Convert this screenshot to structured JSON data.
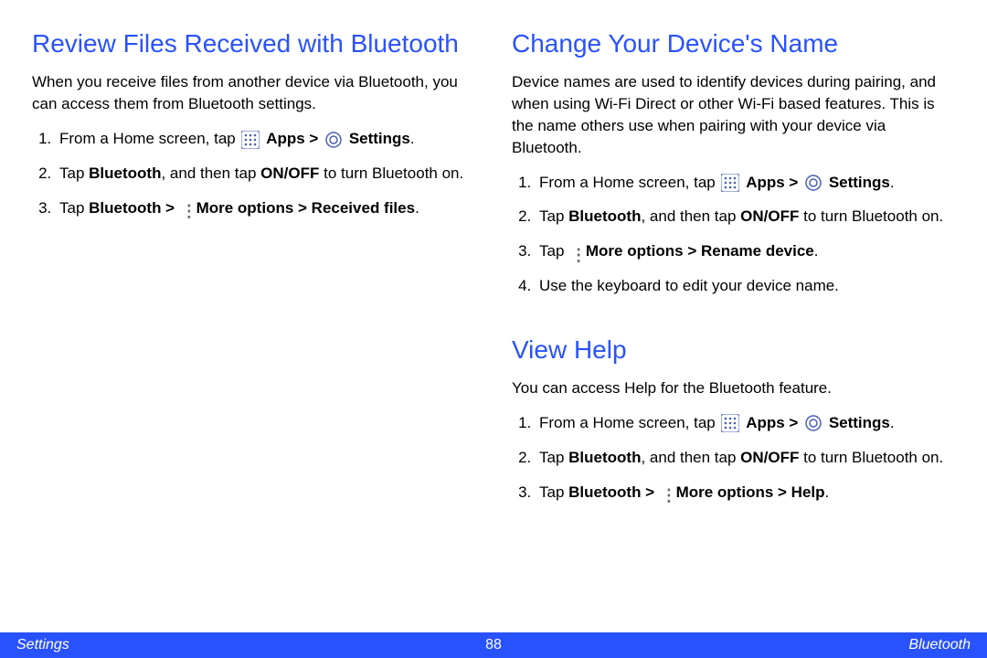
{
  "left": {
    "section1": {
      "heading": "Review Files Received with Bluetooth",
      "intro": "When you receive files from another device via Bluetooth, you can access them from Bluetooth settings.",
      "steps": {
        "s1_prefix": "From a Home screen, tap ",
        "s1_apps": "Apps > ",
        "s1_settings": "Settings",
        "s2_a": "Tap ",
        "s2_b": "Bluetooth",
        "s2_c": ", and then tap ",
        "s2_d": "ON/OFF",
        "s2_e": " to turn Bluetooth on.",
        "s3_a": "Tap ",
        "s3_b": "Bluetooth > ",
        "s3_c": "More options > Received files"
      }
    }
  },
  "right": {
    "section1": {
      "heading": "Change Your Device's Name",
      "intro": "Device names are used to identify devices during pairing, and when using Wi-Fi Direct or other Wi-Fi based features. This is the name others use when pairing with your device via Bluetooth.",
      "steps": {
        "s1_prefix": "From a Home screen, tap ",
        "s1_apps": "Apps > ",
        "s1_settings": "Settings",
        "s2_a": "Tap ",
        "s2_b": "Bluetooth",
        "s2_c": ", and then tap ",
        "s2_d": "ON/OFF",
        "s2_e": " to turn Bluetooth on.",
        "s3_a": "Tap ",
        "s3_b": "More options > Rename device",
        "s4": "Use the keyboard to edit your device name."
      }
    },
    "section2": {
      "heading": "View Help",
      "intro": "You can access Help for the Bluetooth feature.",
      "steps": {
        "s1_prefix": "From a Home screen, tap ",
        "s1_apps": "Apps > ",
        "s1_settings": "Settings",
        "s2_a": "Tap ",
        "s2_b": "Bluetooth",
        "s2_c": ", and then tap ",
        "s2_d": "ON/OFF",
        "s2_e": " to turn Bluetooth on.",
        "s3_a": "Tap ",
        "s3_b": "Bluetooth > ",
        "s3_c": "More options > Help"
      }
    }
  },
  "footer": {
    "left": "Settings",
    "center": "88",
    "right": "Bluetooth"
  }
}
